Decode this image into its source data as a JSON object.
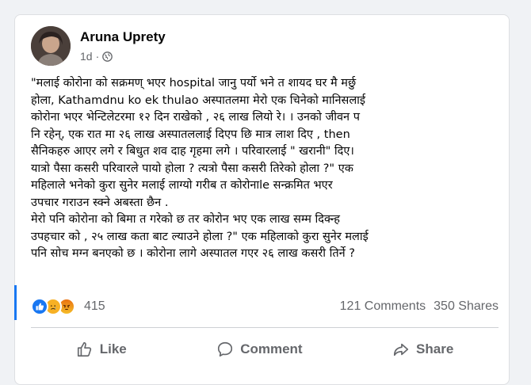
{
  "post": {
    "author": "Aruna Uprety",
    "time": "1d",
    "audience_icon": "globe-icon",
    "text_lines": [
      "\"मलाई कोरोना को सक्रमण् भएर  hospital  जानु पर्यो भने त शायद घर मै मर्छु",
      "होला, Kathamdnu ko    ek thulao  अस्पातलमा मेरो एक चिनेको मानिसलाई",
      "कोरोना भएर भेन्टिलेटरमा १२ दिन राखेको , २६ लाख लियो रे। । उनको जीवन प",
      "नि रहेन्, एक रात मा २६ लाख अस्पातललाई दिएप छि मात्र लाश दिए , then",
      "सैनिकहरु आएर लगे र बिधुत शव दाह गृहमा लगे । परिवारलाई \" खरानी\" दिए।",
      "यात्रो पैसा कसरी परिवारले पायो होला ? त्यत्रो पैसा कसरी तिरेको होला ?\" एक",
      "महिलाले भनेको कुरा सुनेर मलाई लाग्यो गरीब त कोरोनाle  सन्क्रमित भएर",
      "उपचार गराउन स्क्ने अबस्ता छैन .",
      "मेरो पनि कोरोना को बिमा त गरेको छ तर कोरोन भए एक लाख सम्म दिक्न्ह",
      "उपहचार को , २५ लाख कता बाट ल्याउने होला ?\" एक महिलाको कुरा सुनेर मलाई",
      "पनि सोच मग्न बनएको छ । कोरोना लागे अस्पातल गएर २६ लाख कसरी तिर्ने ?"
    ]
  },
  "reactions": {
    "icons": [
      "like-icon",
      "sad-icon",
      "angry-icon"
    ],
    "count": "415",
    "comments": "121 Comments",
    "shares": "350 Shares"
  },
  "actions": {
    "like": "Like",
    "comment": "Comment",
    "share": "Share"
  },
  "colors": {
    "accent": "#1877f2",
    "muted": "#65676b"
  }
}
